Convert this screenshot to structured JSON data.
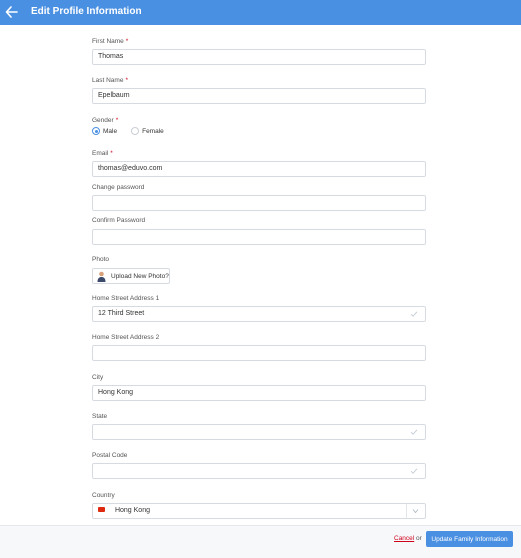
{
  "header": {
    "title": "Edit Profile Information",
    "back_icon": "arrow-left-icon",
    "background": "#4a90e2"
  },
  "form": {
    "first_name": {
      "label": "First Name",
      "required": "*",
      "value": "Thomas"
    },
    "last_name": {
      "label": "Last Name",
      "required": "*",
      "value": "Epelbaum"
    },
    "gender": {
      "label": "Gender",
      "required": "*",
      "options": [
        {
          "label": "Male",
          "selected": true
        },
        {
          "label": "Female",
          "selected": false
        }
      ]
    },
    "email": {
      "label": "Email",
      "required": "*",
      "value": "thomas@eduvo.com"
    },
    "change_password": {
      "label": "Change password",
      "value": ""
    },
    "confirm_password": {
      "label": "Confirm Password",
      "value": ""
    },
    "photo": {
      "label": "Photo",
      "button_label": "Upload New Photo?"
    },
    "home_address_1": {
      "label": "Home Street Address 1",
      "value": "12 Third Street",
      "icon": "check-icon"
    },
    "home_address_2": {
      "label": "Home Street Address 2",
      "value": ""
    },
    "city": {
      "label": "City",
      "value": "Hong Kong"
    },
    "state": {
      "label": "State",
      "value": "",
      "icon": "check-icon"
    },
    "postal_code": {
      "label": "Postal Code",
      "value": "",
      "icon": "check-icon"
    },
    "country": {
      "label": "Country",
      "value": "Hong Kong",
      "flag_icon": "hong-kong-flag-icon",
      "caret_icon": "chevron-down-icon"
    }
  },
  "footer": {
    "cancel_label": "Cancel",
    "or_label": "or",
    "update_label": "Update Family Information",
    "accent": "#4a90e2",
    "cancel_color": "#d0021b"
  }
}
